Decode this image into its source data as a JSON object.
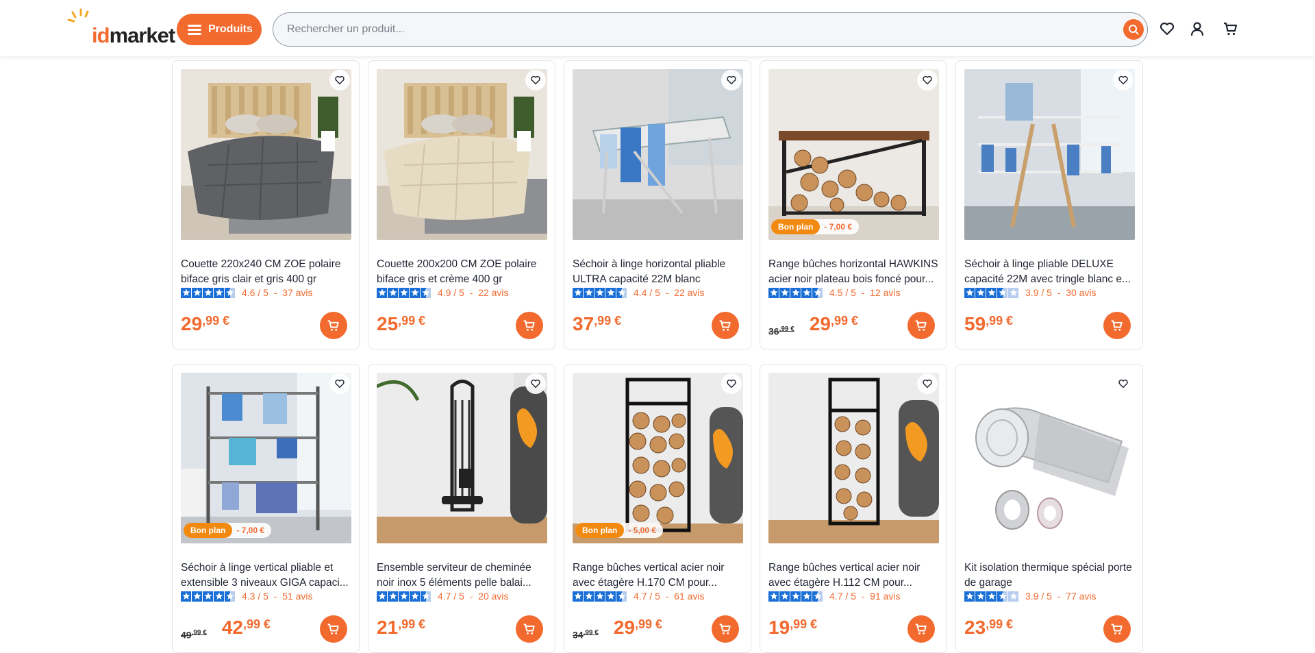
{
  "header": {
    "logo": {
      "text_id": "id",
      "text_market": "market",
      "icon": "logo-burst-icon"
    },
    "products_button": "Produits",
    "search_placeholder": "Rechercher un produit...",
    "icons": [
      "search-icon",
      "heart-icon",
      "user-icon",
      "cart-icon"
    ],
    "accent_color": "#f26a2e"
  },
  "products": [
    {
      "title": "Couette 220x240 CM ZOE polaire biface gris clair et gris 400 gr",
      "rating": "4.6 / 5",
      "reviews": "37 avis",
      "stars": 4.6,
      "price_int": "29",
      "price_cents": ",99 €",
      "old_price": null,
      "badge": null,
      "discount": null,
      "image": "grey-duvet"
    },
    {
      "title": "Couette 200x200 CM ZOE polaire biface gris et crème 400 gr",
      "rating": "4.9 / 5",
      "reviews": "22 avis",
      "stars": 4.9,
      "price_int": "25",
      "price_cents": ",99 €",
      "old_price": null,
      "badge": null,
      "discount": null,
      "image": "cream-duvet"
    },
    {
      "title": "Séchoir à linge horizontal pliable ULTRA capacité 22M blanc",
      "rating": "4.4 / 5",
      "reviews": "22 avis",
      "stars": 4.4,
      "price_int": "37",
      "price_cents": ",99 €",
      "old_price": null,
      "badge": null,
      "discount": null,
      "image": "drying-rack-horizontal"
    },
    {
      "title": "Range bûches horizontal HAWKINS acier noir plateau bois foncé pour...",
      "rating": "4.5 / 5",
      "reviews": "12 avis",
      "stars": 4.5,
      "price_int": "29",
      "price_cents": ",99 €",
      "old_price": "36",
      "old_cents": ",99 €",
      "badge": "Bon plan",
      "discount": "- 7,00 €",
      "image": "log-rack-horizontal"
    },
    {
      "title": "Séchoir à linge pliable DELUXE capacité 22M avec tringle blanc e...",
      "rating": "3.9 / 5",
      "reviews": "30 avis",
      "stars": 3.9,
      "price_int": "59",
      "price_cents": ",99 €",
      "old_price": null,
      "badge": null,
      "discount": null,
      "image": "drying-rack-deluxe"
    },
    {
      "title": "Séchoir à linge vertical pliable et extensible 3 niveaux GIGA capaci...",
      "rating": "4.3 / 5",
      "reviews": "51 avis",
      "stars": 4.3,
      "price_int": "42",
      "price_cents": ",99 €",
      "old_price": "49",
      "old_cents": ",99 €",
      "badge": "Bon plan",
      "discount": "- 7,00 €",
      "image": "drying-rack-vertical"
    },
    {
      "title": "Ensemble serviteur de cheminée noir inox 5 éléments pelle balai...",
      "rating": "4.7 / 5",
      "reviews": "20 avis",
      "stars": 4.7,
      "price_int": "21",
      "price_cents": ",99 €",
      "old_price": null,
      "badge": null,
      "discount": null,
      "image": "fireplace-tools"
    },
    {
      "title": "Range bûches vertical acier noir avec étagère H.170 CM pour...",
      "rating": "4.7 / 5",
      "reviews": "61 avis",
      "stars": 4.7,
      "price_int": "29",
      "price_cents": ",99 €",
      "old_price": "34",
      "old_cents": ",99 €",
      "badge": "Bon plan",
      "discount": "- 5,00 €",
      "image": "log-rack-tall"
    },
    {
      "title": "Range bûches vertical acier noir avec étagère H.112 CM pour...",
      "rating": "4.7 / 5",
      "reviews": "91 avis",
      "stars": 4.7,
      "price_int": "19",
      "price_cents": ",99 €",
      "old_price": null,
      "badge": null,
      "discount": null,
      "image": "log-rack-medium"
    },
    {
      "title": "Kit isolation thermique spécial porte de garage",
      "rating": "3.9 / 5",
      "reviews": "77 avis",
      "stars": 3.9,
      "price_int": "23",
      "price_cents": ",99 €",
      "old_price": null,
      "badge": null,
      "discount": null,
      "image": "insulation-roll"
    }
  ]
}
